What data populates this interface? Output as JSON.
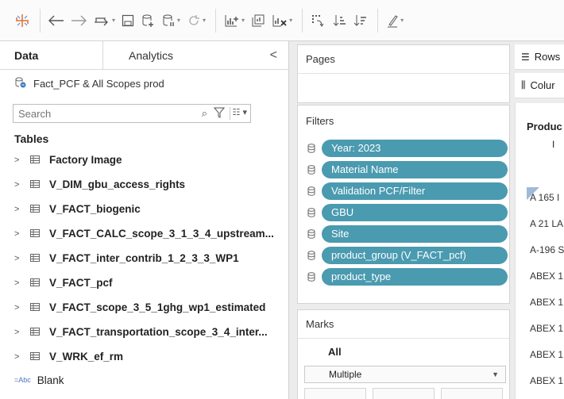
{
  "left_pane": {
    "tabs": [
      {
        "label": "Data"
      },
      {
        "label": "Analytics"
      }
    ],
    "collapse_glyph": "<",
    "datasource": "Fact_PCF & All Scopes prod",
    "search": {
      "placeholder": "Search"
    },
    "tables_heading": "Tables",
    "tables": [
      {
        "label": "Factory Image"
      },
      {
        "label": "V_DIM_gbu_access_rights"
      },
      {
        "label": "V_FACT_biogenic"
      },
      {
        "label": "V_FACT_CALC_scope_3_1_3_4_upstream..."
      },
      {
        "label": "V_FACT_inter_contrib_1_2_3_3_WP1"
      },
      {
        "label": "V_FACT_pcf"
      },
      {
        "label": "V_FACT_scope_3_5_1ghg_wp1_estimated"
      },
      {
        "label": "V_FACT_transportation_scope_3_4_inter..."
      },
      {
        "label": "V_WRK_ef_rm"
      }
    ],
    "field": {
      "type_badge": "=Abc",
      "label": "Blank"
    }
  },
  "pages": {
    "title": "Pages"
  },
  "filters": {
    "title": "Filters",
    "items": [
      {
        "label": "Year: 2023"
      },
      {
        "label": "Material Name"
      },
      {
        "label": "Validation PCF/Filter"
      },
      {
        "label": "GBU"
      },
      {
        "label": "Site"
      },
      {
        "label": "product_group (V_FACT_pcf)"
      },
      {
        "label": "product_type"
      }
    ]
  },
  "marks": {
    "title": "Marks",
    "all_label": "All",
    "mark_type": "Multiple"
  },
  "shelves": {
    "rows_label": "Rows",
    "columns_label": "Colur"
  },
  "view": {
    "header": "Produc",
    "sub": "I",
    "rows": [
      "A 165 I",
      "A 21 LA",
      "A-196 S",
      "ABEX 1",
      "ABEX 1",
      "ABEX 1",
      "ABEX 1",
      "ABEX 1"
    ]
  },
  "colors": {
    "pill": "#4a9ab0",
    "accent_mark": "#8aa7cf"
  },
  "toolbar_icons": [
    "tableau-logo-icon",
    "back-arrow-icon",
    "forward-arrow-icon",
    "redo-cycle-icon",
    "save-icon",
    "new-datasource-icon",
    "pause-icon",
    "refresh-icon",
    "new-worksheet-icon",
    "duplicate-icon",
    "clear-sheet-icon",
    "swap-icon",
    "sort-ascending-icon",
    "sort-descending-icon",
    "highlight-icon"
  ]
}
